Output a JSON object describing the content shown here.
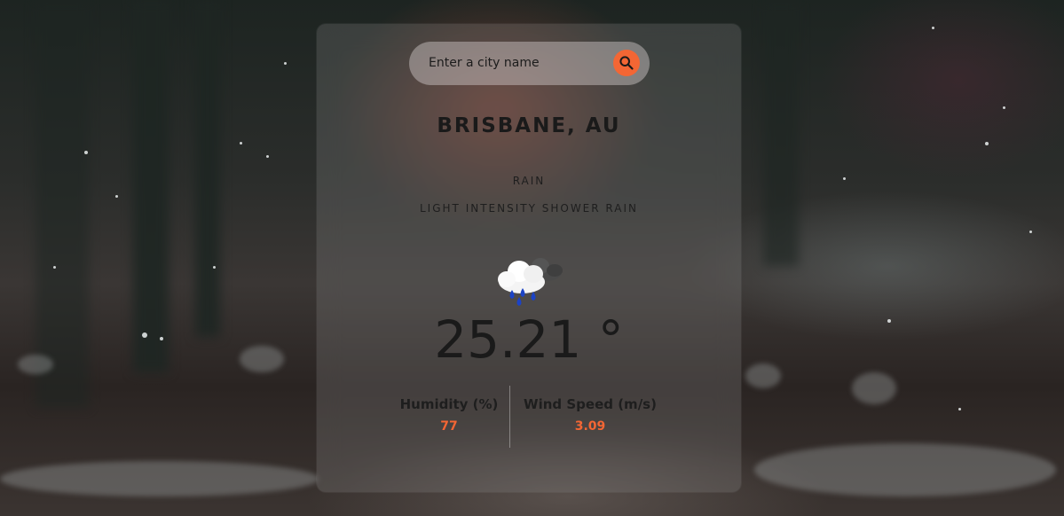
{
  "search": {
    "placeholder": "Enter a city name",
    "button_icon": "search-icon"
  },
  "weather": {
    "location": "BRISBANE, AU",
    "main": "RAIN",
    "description": "LIGHT INTENSITY SHOWER RAIN",
    "icon": "shower-rain-icon",
    "temperature": "25.21 °"
  },
  "stats": {
    "humidity_label": "Humidity (%)",
    "humidity_value": "77",
    "wind_label": "Wind Speed (m/s)",
    "wind_value": "3.09"
  },
  "colors": {
    "accent": "#f36634",
    "text": "#1a1a1a"
  }
}
